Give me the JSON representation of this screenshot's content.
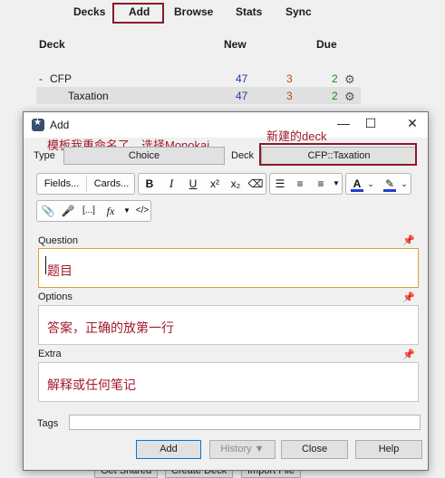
{
  "main_window": {
    "nav": [
      "Decks",
      "Add",
      "Browse",
      "Stats",
      "Sync"
    ],
    "columns": {
      "deck": "Deck",
      "new": "New",
      "due": "Due"
    },
    "decks": [
      {
        "toggle": "-",
        "name": "CFP",
        "new": "47",
        "learn": "3",
        "due": "2"
      },
      {
        "toggle": "",
        "name": "Taxation",
        "new": "47",
        "learn": "3",
        "due": "2"
      }
    ],
    "bottom_buttons": [
      "Get Shared",
      "Create Deck",
      "Import File"
    ]
  },
  "dialog": {
    "title": "Add",
    "window_controls": {
      "minimize": "—",
      "maximize": "☐",
      "close": "✕"
    },
    "type_label": "Type",
    "type_value": "Choice",
    "deck_label": "Deck",
    "deck_value": "CFP::Taxation",
    "annotation_type": "模板我重命名了，选择Monokai",
    "annotation_deck": "新建的deck",
    "toolbar": {
      "fields": "Fields...",
      "cards": "Cards...",
      "bold": "B",
      "italic": "I",
      "underline": "U",
      "superscript": "x²",
      "subscript": "x₂",
      "clear": "⌫",
      "bullet_list": "☰",
      "numbered_list": "≡",
      "align": "≡",
      "text_color": "A",
      "highlight": "✎",
      "attach": "📎",
      "record": "🎤",
      "cloze": "[...]",
      "math": "fx",
      "html": "</>",
      "text_color_accent": "#1f3fd6",
      "highlight_accent": "#1f3fd6"
    },
    "fields": [
      {
        "label": "Question",
        "value": "题目",
        "focused": true
      },
      {
        "label": "Options",
        "value": "答案，正确的放第一行",
        "focused": false
      },
      {
        "label": "Extra",
        "value": "解释或任何笔记",
        "focused": false
      }
    ],
    "tags_label": "Tags",
    "tags_value": "",
    "buttons": {
      "add": "Add",
      "history": "History ▼",
      "close": "Close",
      "help": "Help"
    }
  }
}
